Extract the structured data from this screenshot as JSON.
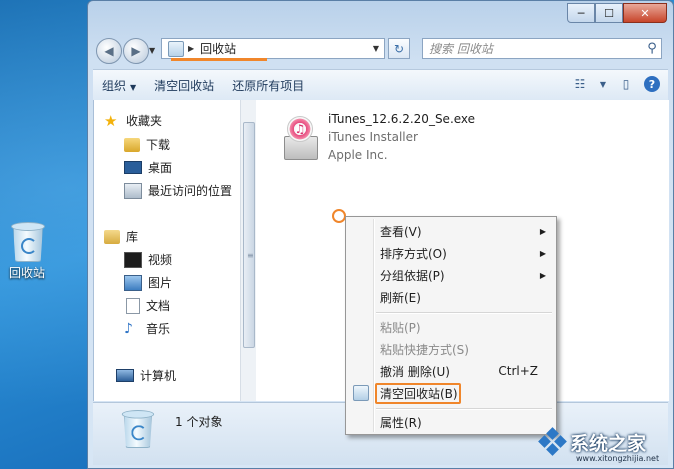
{
  "desktop": {
    "icon_label": "回收站"
  },
  "window": {
    "caption_min": "─",
    "caption_max": "☐",
    "caption_close": "✕"
  },
  "nav": {
    "back": "◀",
    "forward": "▶",
    "dropdown": "▼",
    "breadcrumb_sep": "▶",
    "address": "回收站",
    "address_drop": "▼",
    "refresh": "↻",
    "search_placeholder": "搜索 回收站",
    "search_icon": "⚲"
  },
  "toolbar": {
    "organize": "组织",
    "organize_arrow": "▼",
    "empty_bin": "清空回收站",
    "restore_all": "还原所有项目",
    "view_icon": "☷",
    "view_arrow": "▼",
    "pane_icon": "▯",
    "help": "?"
  },
  "sidebar": {
    "favorites": "收藏夹",
    "favorites_icon": "star-icon",
    "downloads": "下载",
    "desktop": "桌面",
    "recent": "最近访问的位置",
    "libraries": "库",
    "videos": "视频",
    "pictures": "图片",
    "documents": "文档",
    "music": "音乐",
    "music_glyph": "♪",
    "computer": "计算机",
    "scroll_grip": "≡"
  },
  "file": {
    "name": "iTunes_12.6.2.20_Se.exe",
    "type": "iTunes Installer",
    "company": "Apple Inc.",
    "disc_glyph": "♫"
  },
  "status": {
    "count": "1 个对象"
  },
  "context_menu": {
    "items": [
      {
        "label": "查看(V)",
        "submenu": "▶",
        "disabled": false
      },
      {
        "label": "排序方式(O)",
        "submenu": "▶",
        "disabled": false
      },
      {
        "label": "分组依据(P)",
        "submenu": "▶",
        "disabled": false
      },
      {
        "label": "刷新(E)",
        "disabled": false
      },
      {
        "label": "粘贴(P)",
        "disabled": true
      },
      {
        "label": "粘贴快捷方式(S)",
        "disabled": true
      },
      {
        "label": "撤消 删除(U)",
        "shortcut": "Ctrl+Z",
        "disabled": false
      },
      {
        "label": "清空回收站(B)",
        "disabled": false,
        "highlighted": true
      },
      {
        "label": "属性(R)",
        "disabled": false
      }
    ]
  },
  "watermark": {
    "text": "系统之家",
    "url": "www.xitongzhijia.net"
  },
  "colors": {
    "highlight": "#f0862b",
    "desktop": "#1b73bf"
  }
}
